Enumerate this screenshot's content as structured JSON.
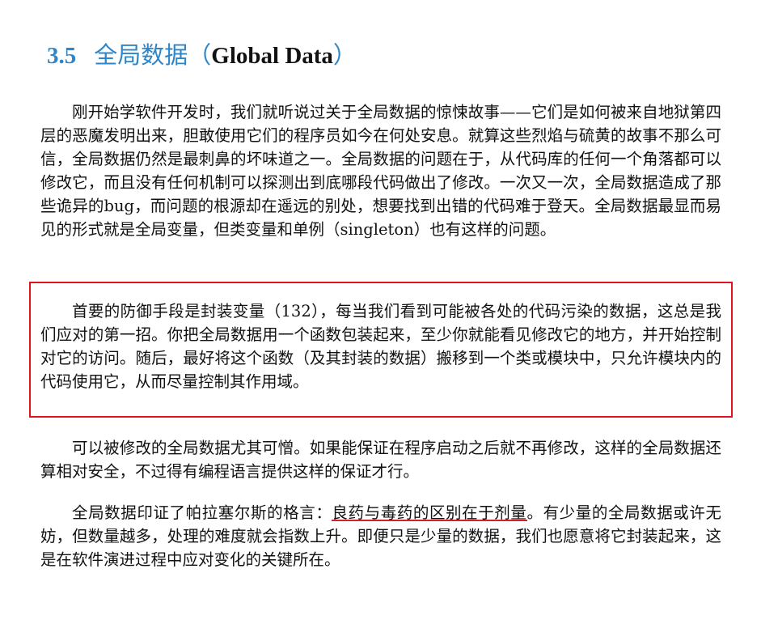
{
  "section": {
    "number": "3.5",
    "title_cn": "全局数据（",
    "title_en": "Global Data",
    "title_close": "）"
  },
  "paragraphs": {
    "p1": "刚开始学软件开发时，我们就听说过关于全局数据的惊悚故事——它们是如何被来自地狱第四层的恶魔发明出来，胆敢使用它们的程序员如今在何处安息。就算这些烈焰与硫黄的故事不那么可信，全局数据仍然是最刺鼻的坏味道之一。全局数据的问题在于，从代码库的任何一个角落都可以修改它，而且没有任何机制可以探测出到底哪段代码做出了修改。一次又一次，全局数据造成了那些诡异的bug，而问题的根源却在遥远的别处，想要找到出错的代码难于登天。全局数据最显而易见的形式就是全局变量，但类变量和单例（singleton）也有这样的问题。",
    "p2": "首要的防御手段是封装变量（132），每当我们看到可能被各处的代码污染的数据，这总是我们应对的第一招。你把全局数据用一个函数包装起来，至少你就能看见修改它的地方，并开始控制对它的访问。随后，最好将这个函数（及其封装的数据）搬移到一个类或模块中，只允许模块内的代码使用它，从而尽量控制其作用域。",
    "p3": "可以被修改的全局数据尤其可憎。如果能保证在程序启动之后就不再修改，这样的全局数据还算相对安全，不过得有编程语言提供这样的保证才行。",
    "p4_before": "全局数据印证了帕拉塞尔斯的格言：",
    "p4_underlined": "良药与毒药的区别在于剂量",
    "p4_after": "。有少量的全局数据或许无妨，但数量越多，处理的难度就会指数上升。即便只是少量的数据，我们也愿意将它封装起来，这是在软件演进过程中应对变化的关键所在。"
  },
  "colors": {
    "heading_accent": "#2e86c8",
    "box_border": "#e0141e",
    "underline": "#d1222b"
  }
}
